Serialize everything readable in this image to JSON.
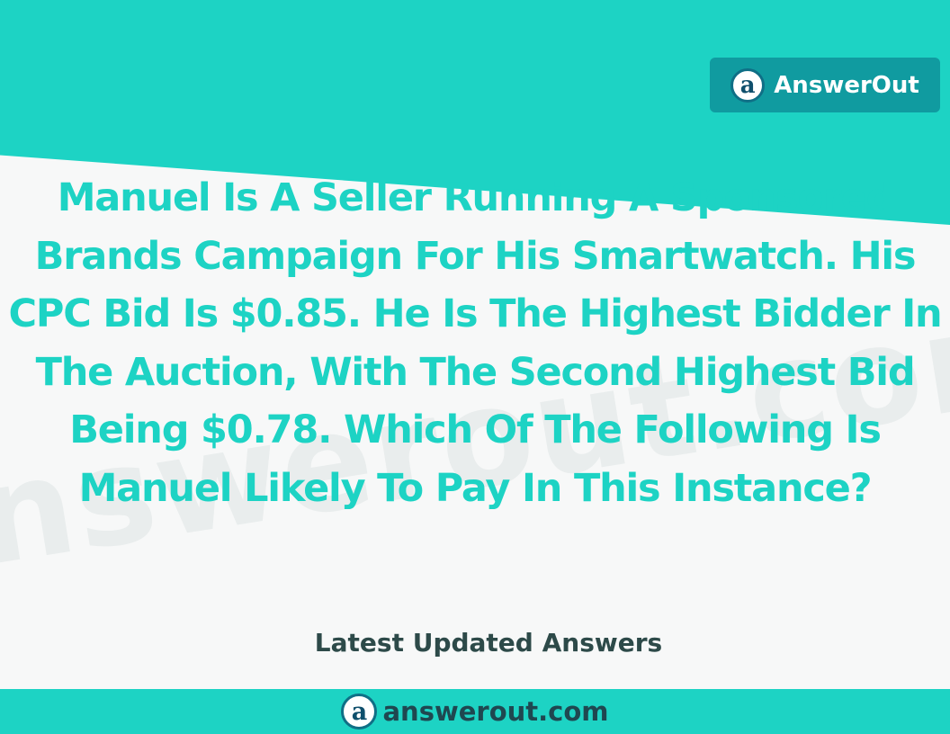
{
  "brand": {
    "name": "AnswerOut",
    "logo_letter": "a"
  },
  "watermark": "answerout.com",
  "question": "Manuel Is A Seller Running A Sponsored Brands Campaign For His Smartwatch. His CPC Bid Is $0.85. He Is The Highest Bidder In The Auction, With The Second Highest Bid Being $0.78. Which Of The Following Is Manuel Likely To Pay In This Instance?",
  "tagline": "Latest Updated Answers",
  "footer": {
    "site": "answerout.com",
    "logo_letter": "a"
  },
  "colors": {
    "accent": "#1dd3c4",
    "badge": "#109ba0",
    "dark_text": "#2d4a49"
  }
}
